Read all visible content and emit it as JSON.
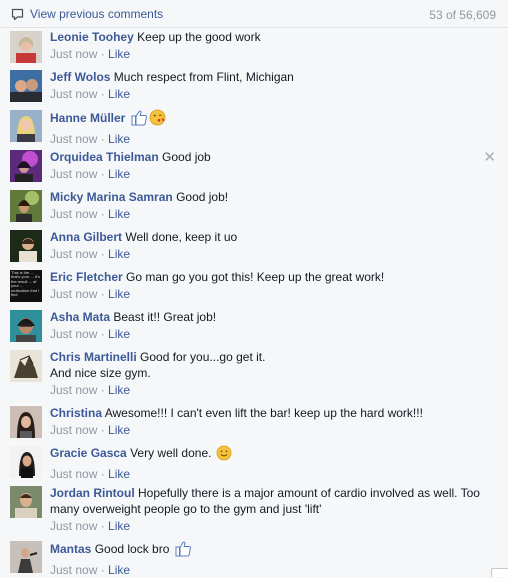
{
  "header": {
    "view_previous_label": "View previous comments",
    "count_label": "53 of 56,609"
  },
  "meta": {
    "time": "Just now",
    "separator": " · ",
    "like": "Like"
  },
  "comments": [
    {
      "author": "Leonie Toohey",
      "text": "Keep up the good work"
    },
    {
      "author": "Jeff Wolos",
      "text": "Much respect from Flint, Michigan"
    },
    {
      "author": "Hanne Müller",
      "text": ""
    },
    {
      "author": "Orquidea Thielman",
      "text": "Good job"
    },
    {
      "author": "Micky Marina Samran",
      "text": "Good job!"
    },
    {
      "author": "Anna Gilbert",
      "text": "Well done, keep it uo"
    },
    {
      "author": "Eric Fletcher",
      "text": "Go man go you got this! Keep up the great work!"
    },
    {
      "author": "Asha Mata",
      "text": "Beast it!! Great job!"
    },
    {
      "author": "Chris Martinelli",
      "text": "Good for you...go get it.",
      "text2": "And nice size gym."
    },
    {
      "author": "Christina",
      "text": "Awesome!!! I can't even lift the bar! keep up the hard work!!!"
    },
    {
      "author": "Gracie Gasca",
      "text": "Very well done."
    },
    {
      "author": "Jordan Rintoul",
      "text": "Hopefully there is a major amount of cardio involved as well. Too many overweight people go to the gym and just 'lift'"
    },
    {
      "author": "Mantas",
      "text": "Good lock bro"
    }
  ],
  "avatar_placeholder_text": "",
  "eric_avatar_text": "This is the ... that's your ... It's the result ... of your ... motivation that I find",
  "colors": {
    "link": "#3b5998",
    "meta": "#9197a3",
    "background": "#f6f7f9",
    "divider": "#e5e6e9"
  },
  "icons": {
    "view_previous": "speech-bubble-icon",
    "close": "close-icon",
    "thumbs_up": "thumbs-up-icon",
    "smile": "smile-emoji-icon",
    "wink_kiss": "kiss-emoji-icon"
  }
}
